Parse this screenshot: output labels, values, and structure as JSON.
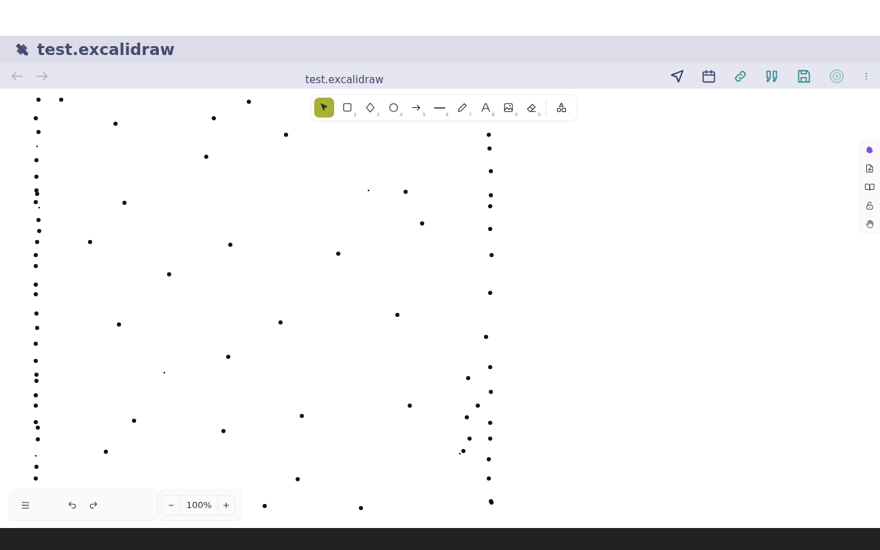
{
  "window": {
    "title": "test.excalidraw"
  },
  "navbar": {
    "back_disabled": true,
    "forward_disabled": true,
    "file_name": "test.excalidraw"
  },
  "tools": [
    {
      "kind": "selection",
      "shortcut": "1",
      "selected": true
    },
    {
      "kind": "rectangle",
      "shortcut": "2",
      "selected": false
    },
    {
      "kind": "diamond",
      "shortcut": "3",
      "selected": false
    },
    {
      "kind": "ellipse",
      "shortcut": "4",
      "selected": false
    },
    {
      "kind": "arrow",
      "shortcut": "5",
      "selected": false
    },
    {
      "kind": "line",
      "shortcut": "6",
      "selected": false
    },
    {
      "kind": "pencil",
      "shortcut": "7",
      "selected": false
    },
    {
      "kind": "text",
      "shortcut": "8",
      "selected": false
    },
    {
      "kind": "image",
      "shortcut": "9",
      "selected": false
    },
    {
      "kind": "eraser",
      "shortcut": "0",
      "selected": false
    },
    {
      "kind": "library",
      "selected": false
    }
  ],
  "zoom": {
    "value": "100%"
  }
}
